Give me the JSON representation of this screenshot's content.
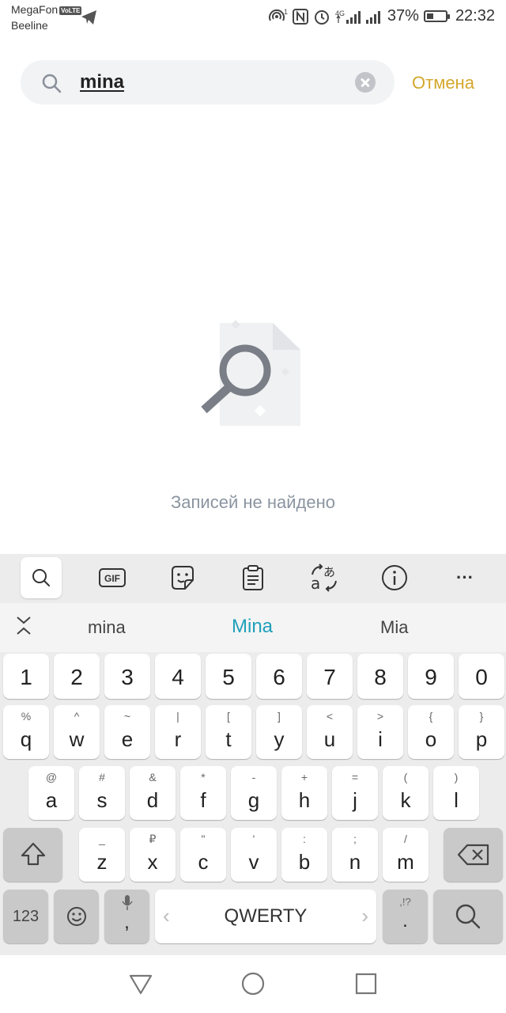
{
  "status_bar": {
    "carrier_primary": "MegaFon",
    "volte": "VoLTE",
    "carrier_secondary": "Beeline",
    "network": "4G",
    "sim_badge": "1",
    "battery": "37%",
    "battery_level": 0.37,
    "time": "22:32"
  },
  "search": {
    "query": "mina",
    "cancel_label": "Отмена"
  },
  "empty_state": {
    "message": "Записей не найдено"
  },
  "keyboard": {
    "toolbar": [
      "search-icon",
      "gif-icon",
      "sticker-icon",
      "clipboard-icon",
      "translate-icon",
      "info-icon",
      "more-icon"
    ],
    "gif_label": "GIF",
    "more_label": "···",
    "suggestions": [
      "mina",
      "Mina",
      "Mia"
    ],
    "number_row": [
      "1",
      "2",
      "3",
      "4",
      "5",
      "6",
      "7",
      "8",
      "9",
      "0"
    ],
    "row1": [
      {
        "main": "q",
        "sub": "%"
      },
      {
        "main": "w",
        "sub": "^"
      },
      {
        "main": "e",
        "sub": "~"
      },
      {
        "main": "r",
        "sub": "|"
      },
      {
        "main": "t",
        "sub": "["
      },
      {
        "main": "y",
        "sub": "]"
      },
      {
        "main": "u",
        "sub": "<"
      },
      {
        "main": "i",
        "sub": ">"
      },
      {
        "main": "o",
        "sub": "{"
      },
      {
        "main": "p",
        "sub": "}"
      }
    ],
    "row2": [
      {
        "main": "a",
        "sub": "@"
      },
      {
        "main": "s",
        "sub": "#"
      },
      {
        "main": "d",
        "sub": "&"
      },
      {
        "main": "f",
        "sub": "*"
      },
      {
        "main": "g",
        "sub": "-"
      },
      {
        "main": "h",
        "sub": "+"
      },
      {
        "main": "j",
        "sub": "="
      },
      {
        "main": "k",
        "sub": "("
      },
      {
        "main": "l",
        "sub": ")"
      }
    ],
    "row3": [
      {
        "main": "z",
        "sub": "_"
      },
      {
        "main": "x",
        "sub": "₽"
      },
      {
        "main": "c",
        "sub": "\""
      },
      {
        "main": "v",
        "sub": "'"
      },
      {
        "main": "b",
        "sub": ":"
      },
      {
        "main": "n",
        "sub": ";"
      },
      {
        "main": "m",
        "sub": "/"
      }
    ],
    "numbers_key": "123",
    "comma_key": ",",
    "space_label": "QWERTY",
    "period_key": ".",
    "period_sub": ",!?"
  },
  "nav_bar": [
    "back-icon",
    "home-icon",
    "recents-icon"
  ]
}
